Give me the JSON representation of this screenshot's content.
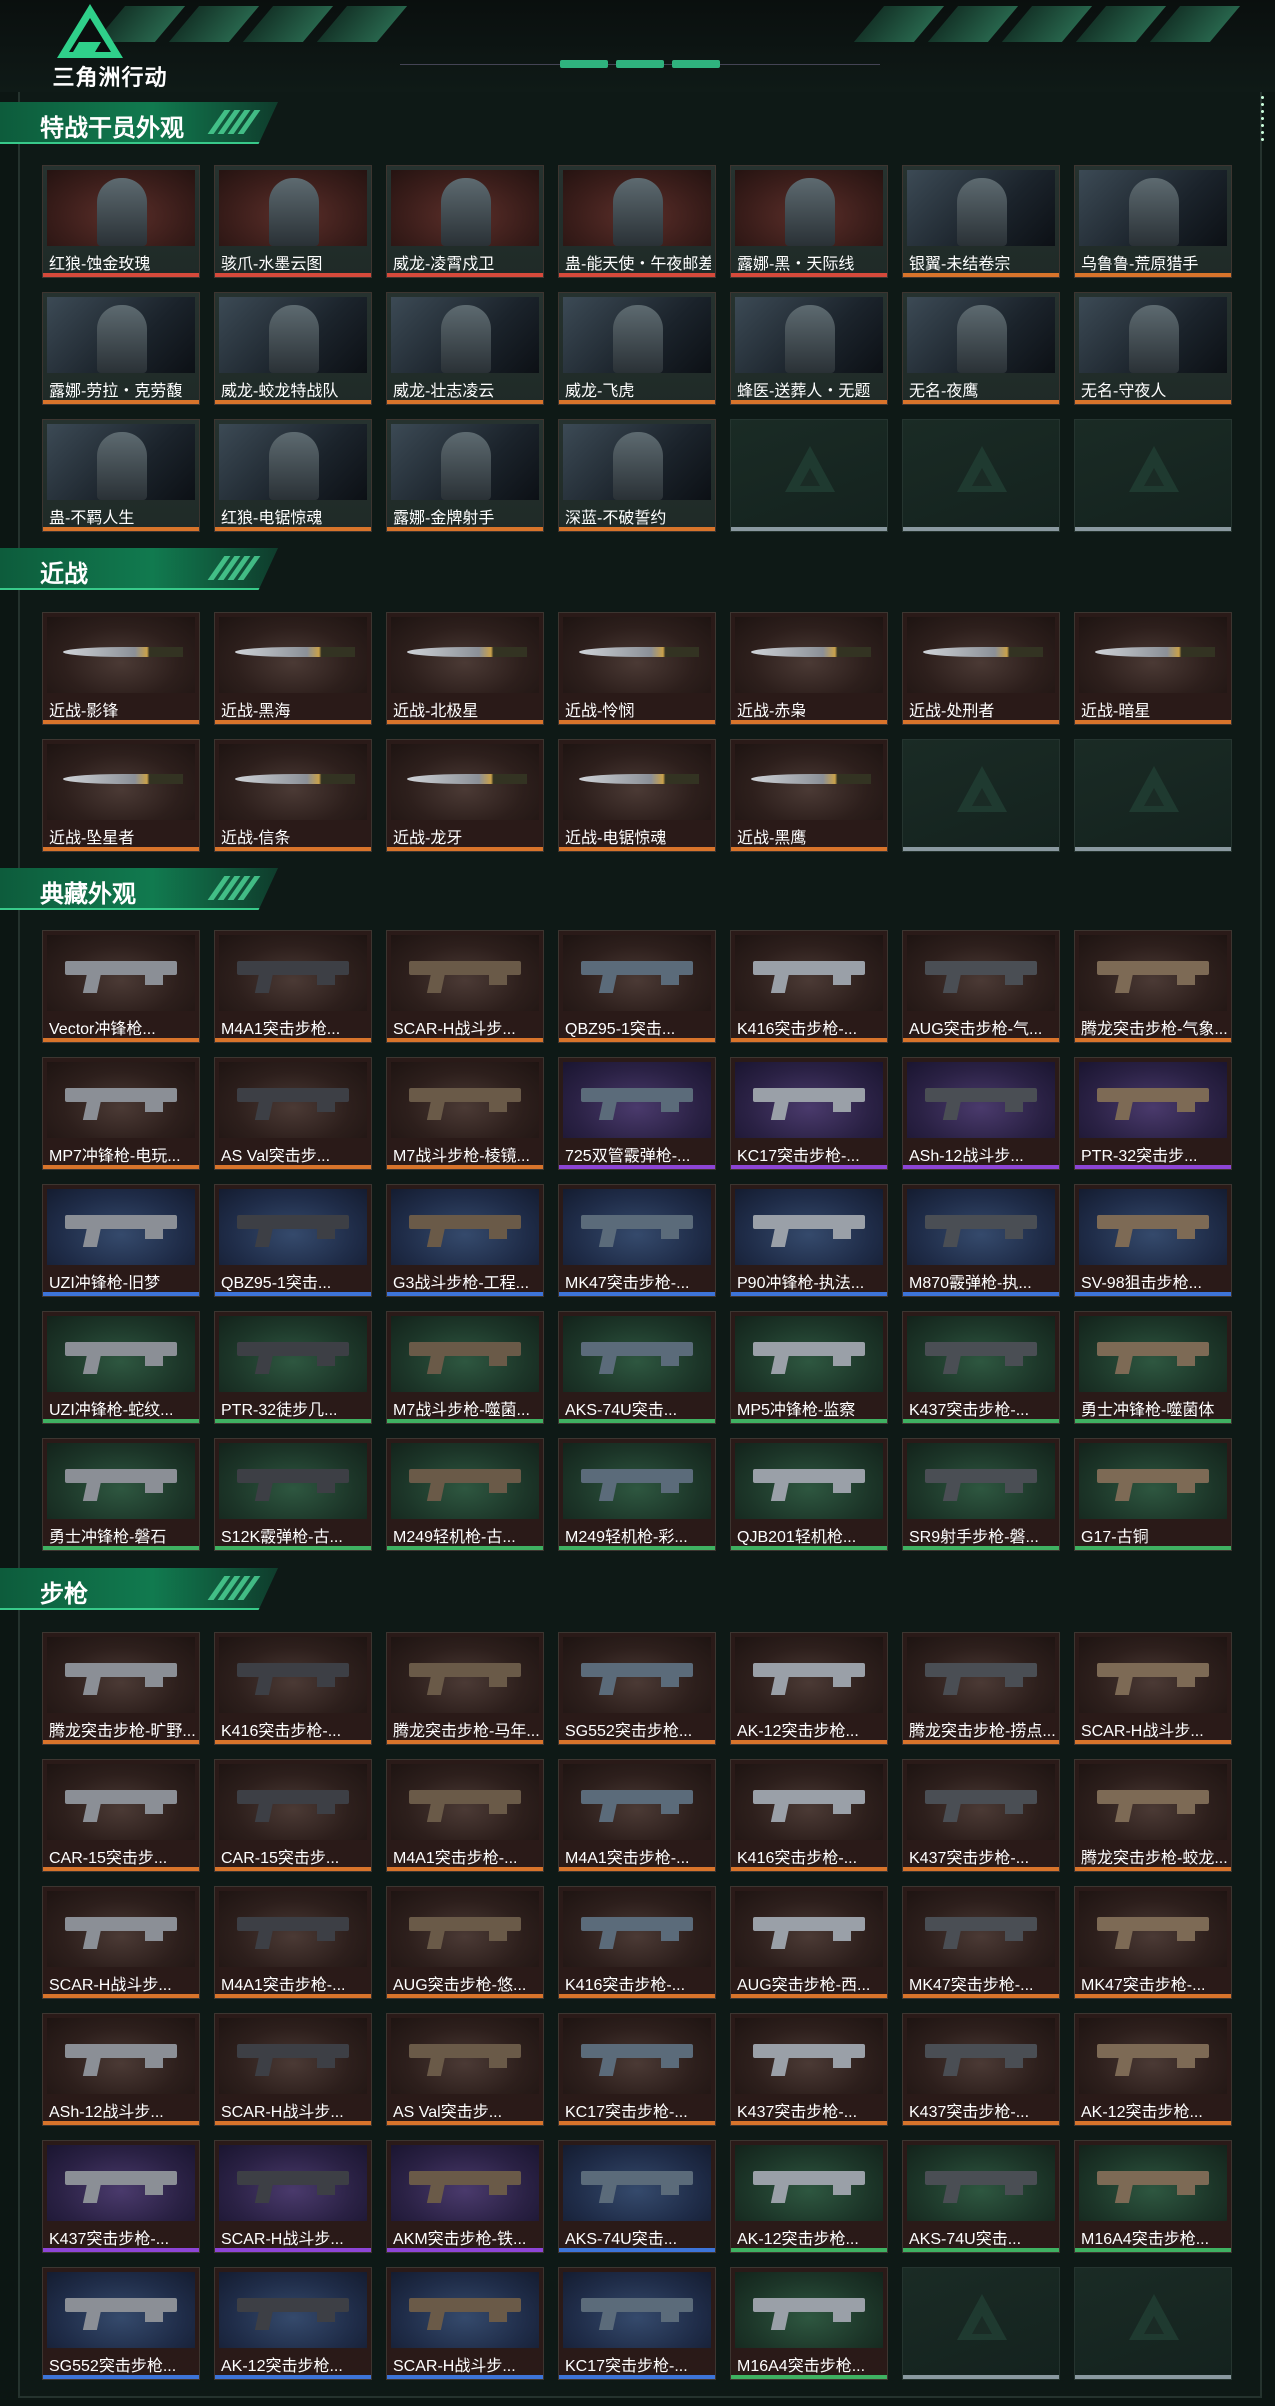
{
  "header": {
    "logo_text": "三角洲行动"
  },
  "colors": {
    "accent": "#38c98a",
    "orange": "#d8742b",
    "purple": "#8d45d6",
    "blue": "#3d74d8",
    "green": "#3fb162",
    "red": "#d64a3b"
  },
  "sections": [
    {
      "title": "特战干员外观",
      "kind": "op",
      "items": [
        {
          "label": "红狼-蚀金玫瑰",
          "rarity": "red"
        },
        {
          "label": "骇爪-水墨云图",
          "rarity": "red"
        },
        {
          "label": "威龙-凌霄戍卫",
          "rarity": "red"
        },
        {
          "label": "蛊-能天使・午夜邮差",
          "rarity": "red"
        },
        {
          "label": "露娜-黑・天际线",
          "rarity": "red"
        },
        {
          "label": "银翼-未结卷宗",
          "rarity": "orange"
        },
        {
          "label": "乌鲁鲁-荒原猎手",
          "rarity": "orange"
        },
        {
          "label": "露娜-劳拉・克劳馥",
          "rarity": "orange"
        },
        {
          "label": "威龙-蛟龙特战队",
          "rarity": "orange"
        },
        {
          "label": "威龙-壮志凌云",
          "rarity": "orange"
        },
        {
          "label": "威龙-飞虎",
          "rarity": "orange"
        },
        {
          "label": "蜂医-送葬人・无题",
          "rarity": "orange"
        },
        {
          "label": "无名-夜鹰",
          "rarity": "orange"
        },
        {
          "label": "无名-守夜人",
          "rarity": "orange"
        },
        {
          "label": "蛊-不羁人生",
          "rarity": "orange"
        },
        {
          "label": "红狼-电锯惊魂",
          "rarity": "orange"
        },
        {
          "label": "露娜-金牌射手",
          "rarity": "orange"
        },
        {
          "label": "深蓝-不破誓约",
          "rarity": "orange"
        },
        {
          "label": "",
          "rarity": "empty"
        },
        {
          "label": "",
          "rarity": "empty"
        },
        {
          "label": "",
          "rarity": "empty"
        }
      ]
    },
    {
      "title": "近战",
      "kind": "melee",
      "items": [
        {
          "label": "近战-影锋",
          "rarity": "orange"
        },
        {
          "label": "近战-黑海",
          "rarity": "orange"
        },
        {
          "label": "近战-北极星",
          "rarity": "orange"
        },
        {
          "label": "近战-怜悯",
          "rarity": "orange"
        },
        {
          "label": "近战-赤枭",
          "rarity": "orange"
        },
        {
          "label": "近战-处刑者",
          "rarity": "orange"
        },
        {
          "label": "近战-暗星",
          "rarity": "orange"
        },
        {
          "label": "近战-坠星者",
          "rarity": "orange"
        },
        {
          "label": "近战-信条",
          "rarity": "orange"
        },
        {
          "label": "近战-龙牙",
          "rarity": "orange"
        },
        {
          "label": "近战-电锯惊魂",
          "rarity": "orange"
        },
        {
          "label": "近战-黑鹰",
          "rarity": "orange"
        },
        {
          "label": "",
          "rarity": "empty"
        },
        {
          "label": "",
          "rarity": "empty"
        }
      ]
    },
    {
      "title": "典藏外观",
      "kind": "weapon",
      "items": [
        {
          "label": "Vector冲锋枪...",
          "rarity": "orange"
        },
        {
          "label": "M4A1突击步枪...",
          "rarity": "orange"
        },
        {
          "label": "SCAR-H战斗步...",
          "rarity": "orange"
        },
        {
          "label": "QBZ95-1突击...",
          "rarity": "orange"
        },
        {
          "label": "K416突击步枪-...",
          "rarity": "orange"
        },
        {
          "label": "AUG突击步枪-气...",
          "rarity": "orange"
        },
        {
          "label": "腾龙突击步枪-气象...",
          "rarity": "orange"
        },
        {
          "label": "MP7冲锋枪-电玩...",
          "rarity": "orange"
        },
        {
          "label": "AS Val突击步...",
          "rarity": "orange"
        },
        {
          "label": "M7战斗步枪-棱镜...",
          "rarity": "orange"
        },
        {
          "label": "725双管霰弹枪-...",
          "rarity": "purple"
        },
        {
          "label": "KC17突击步枪-...",
          "rarity": "purple"
        },
        {
          "label": "ASh-12战斗步...",
          "rarity": "purple"
        },
        {
          "label": "PTR-32突击步...",
          "rarity": "purple"
        },
        {
          "label": "UZI冲锋枪-旧梦",
          "rarity": "blue"
        },
        {
          "label": "QBZ95-1突击...",
          "rarity": "blue"
        },
        {
          "label": "G3战斗步枪-工程...",
          "rarity": "blue"
        },
        {
          "label": "MK47突击步枪-...",
          "rarity": "blue"
        },
        {
          "label": "P90冲锋枪-执法...",
          "rarity": "blue"
        },
        {
          "label": "M870霰弹枪-执...",
          "rarity": "blue"
        },
        {
          "label": "SV-98狙击步枪...",
          "rarity": "blue"
        },
        {
          "label": "UZI冲锋枪-蛇纹...",
          "rarity": "green"
        },
        {
          "label": "PTR-32徒步几...",
          "rarity": "green"
        },
        {
          "label": "M7战斗步枪-噬菌...",
          "rarity": "green"
        },
        {
          "label": "AKS-74U突击...",
          "rarity": "green"
        },
        {
          "label": "MP5冲锋枪-监察",
          "rarity": "green"
        },
        {
          "label": "K437突击步枪-...",
          "rarity": "green"
        },
        {
          "label": "勇士冲锋枪-噬菌体",
          "rarity": "green"
        },
        {
          "label": "勇士冲锋枪-磐石",
          "rarity": "green"
        },
        {
          "label": "S12K霰弹枪-古...",
          "rarity": "green"
        },
        {
          "label": "M249轻机枪-古...",
          "rarity": "green"
        },
        {
          "label": "M249轻机枪-彩...",
          "rarity": "green"
        },
        {
          "label": "QJB201轻机枪...",
          "rarity": "green"
        },
        {
          "label": "SR9射手步枪-磐...",
          "rarity": "green"
        },
        {
          "label": "G17-古铜",
          "rarity": "green"
        }
      ]
    },
    {
      "title": "步枪",
      "kind": "weapon",
      "items": [
        {
          "label": "腾龙突击步枪-旷野...",
          "rarity": "orange"
        },
        {
          "label": "K416突击步枪-...",
          "rarity": "orange"
        },
        {
          "label": "腾龙突击步枪-马年...",
          "rarity": "orange"
        },
        {
          "label": "SG552突击步枪...",
          "rarity": "orange"
        },
        {
          "label": "AK-12突击步枪...",
          "rarity": "orange"
        },
        {
          "label": "腾龙突击步枪-捞点...",
          "rarity": "orange"
        },
        {
          "label": "SCAR-H战斗步...",
          "rarity": "orange"
        },
        {
          "label": "CAR-15突击步...",
          "rarity": "orange"
        },
        {
          "label": "CAR-15突击步...",
          "rarity": "orange"
        },
        {
          "label": "M4A1突击步枪-...",
          "rarity": "orange"
        },
        {
          "label": "M4A1突击步枪-...",
          "rarity": "orange"
        },
        {
          "label": "K416突击步枪-...",
          "rarity": "orange"
        },
        {
          "label": "K437突击步枪-...",
          "rarity": "orange"
        },
        {
          "label": "腾龙突击步枪-蛟龙...",
          "rarity": "orange"
        },
        {
          "label": "SCAR-H战斗步...",
          "rarity": "orange"
        },
        {
          "label": "M4A1突击步枪-...",
          "rarity": "orange"
        },
        {
          "label": "AUG突击步枪-悠...",
          "rarity": "orange"
        },
        {
          "label": "K416突击步枪-...",
          "rarity": "orange"
        },
        {
          "label": "AUG突击步枪-西...",
          "rarity": "orange"
        },
        {
          "label": "MK47突击步枪-...",
          "rarity": "orange"
        },
        {
          "label": "MK47突击步枪-...",
          "rarity": "orange"
        },
        {
          "label": "ASh-12战斗步...",
          "rarity": "orange"
        },
        {
          "label": "SCAR-H战斗步...",
          "rarity": "orange"
        },
        {
          "label": "AS Val突击步...",
          "rarity": "orange"
        },
        {
          "label": "KC17突击步枪-...",
          "rarity": "orange"
        },
        {
          "label": "K437突击步枪-...",
          "rarity": "orange"
        },
        {
          "label": "K437突击步枪-...",
          "rarity": "orange"
        },
        {
          "label": "AK-12突击步枪...",
          "rarity": "orange"
        },
        {
          "label": "K437突击步枪-...",
          "rarity": "purple"
        },
        {
          "label": "SCAR-H战斗步...",
          "rarity": "purple"
        },
        {
          "label": "AKM突击步枪-铁...",
          "rarity": "purple"
        },
        {
          "label": "AKS-74U突击...",
          "rarity": "blue"
        },
        {
          "label": "AK-12突击步枪...",
          "rarity": "green"
        },
        {
          "label": "AKS-74U突击...",
          "rarity": "green"
        },
        {
          "label": "M16A4突击步枪...",
          "rarity": "green"
        },
        {
          "label": "SG552突击步枪...",
          "rarity": "blue"
        },
        {
          "label": "AK-12突击步枪...",
          "rarity": "blue"
        },
        {
          "label": "SCAR-H战斗步...",
          "rarity": "blue"
        },
        {
          "label": "KC17突击步枪-...",
          "rarity": "blue"
        },
        {
          "label": "M16A4突击步枪...",
          "rarity": "green"
        },
        {
          "label": "",
          "rarity": "empty"
        },
        {
          "label": "",
          "rarity": "empty"
        }
      ]
    }
  ]
}
